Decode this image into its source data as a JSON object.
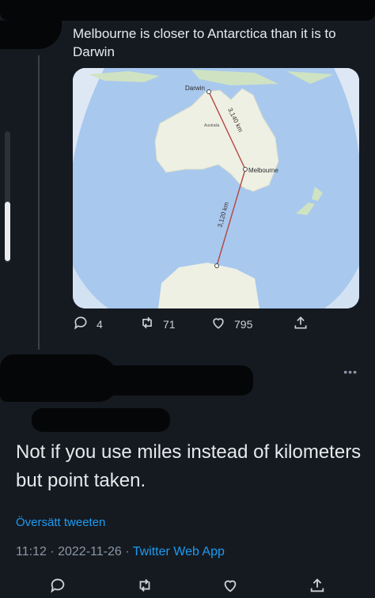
{
  "tweet": {
    "text": "Melbourne is closer to Antarctica than it is to Darwin",
    "map": {
      "labels": {
        "darwin": "Darwin",
        "melbourne": "Melbourne",
        "australia": "Australia",
        "dist_north": "3,140 km",
        "dist_south": "3,120 km"
      }
    },
    "actions": {
      "replies": "4",
      "retweets": "71",
      "likes": "795"
    }
  },
  "reply": {
    "text": "Not if you use miles instead of kilometers but point taken.",
    "translate_label": "Översätt tweeten",
    "time": "11:12",
    "date": "2022-11-26",
    "separator": "·",
    "app": "Twitter Web App"
  },
  "colors": {
    "background": "#151a21",
    "text": "#e7e9ea",
    "muted": "#8b98a5",
    "link": "#1d9bf0",
    "ocean": "#a8c8ee",
    "land": "#eef0e4",
    "route": "#b5453e"
  },
  "icons": {
    "reply": "comment-icon",
    "retweet": "retweet-icon",
    "like": "heart-icon",
    "share": "share-icon",
    "more": "more-dots-icon"
  }
}
